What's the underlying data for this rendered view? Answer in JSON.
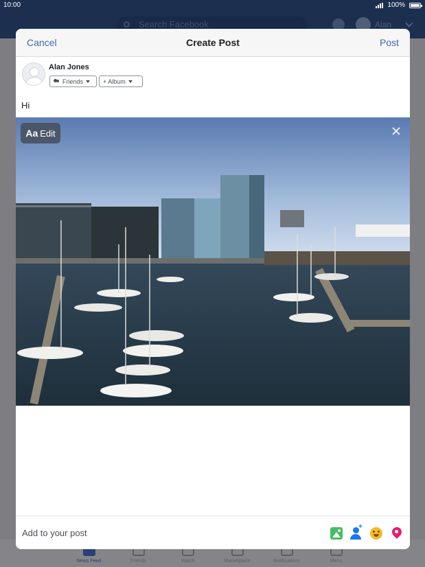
{
  "status_bar": {
    "time": "10:00",
    "battery": "100%"
  },
  "fb_header": {
    "search_placeholder": "Search Facebook",
    "user_name": "Alan"
  },
  "tab_bar": {
    "tabs": [
      "News Feed",
      "Friends",
      "Watch",
      "Marketplace",
      "Notifications",
      "Menu"
    ]
  },
  "modal": {
    "cancel_label": "Cancel",
    "title": "Create Post",
    "post_label": "Post",
    "author_name": "Alan Jones",
    "audience_label": "Friends",
    "album_label": "+ Album",
    "post_text": "Hi",
    "edit_aa": "Aa",
    "edit_label": "Edit",
    "add_to_post_label": "Add to your post",
    "add_icons": [
      "photo-video-icon",
      "tag-people-icon",
      "feeling-icon",
      "location-icon"
    ],
    "colors": {
      "accent": "#4267b2",
      "photo_icon": "#45bd62",
      "tag_icon": "#1877f2",
      "feeling_icon": "#f7b928",
      "location_icon": "#e41e6d"
    }
  }
}
